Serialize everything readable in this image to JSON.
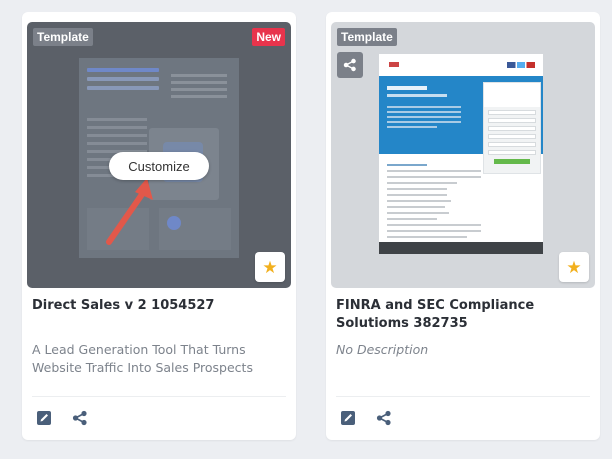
{
  "cards": [
    {
      "badge_template": "Template",
      "badge_new": "New",
      "customize_label": "Customize",
      "title": "Direct Sales v 2 1054527",
      "description": "A Lead Generation Tool That Turns Website Traffic Into Sales Prospects",
      "star_icon": "star-icon",
      "edit_icon": "edit-icon",
      "share_icon": "share-icon"
    },
    {
      "badge_template": "Template",
      "title": "FINRA and SEC Compliance Solutioms 382735",
      "description": "No Description",
      "star_icon": "star-icon",
      "edit_icon": "edit-icon",
      "share_icon": "share-icon"
    }
  ],
  "colors": {
    "accent_star": "#f2b01e",
    "badge_new": "#e8344c",
    "arrow": "#e2584a",
    "preview_blue": "#2486c8"
  }
}
